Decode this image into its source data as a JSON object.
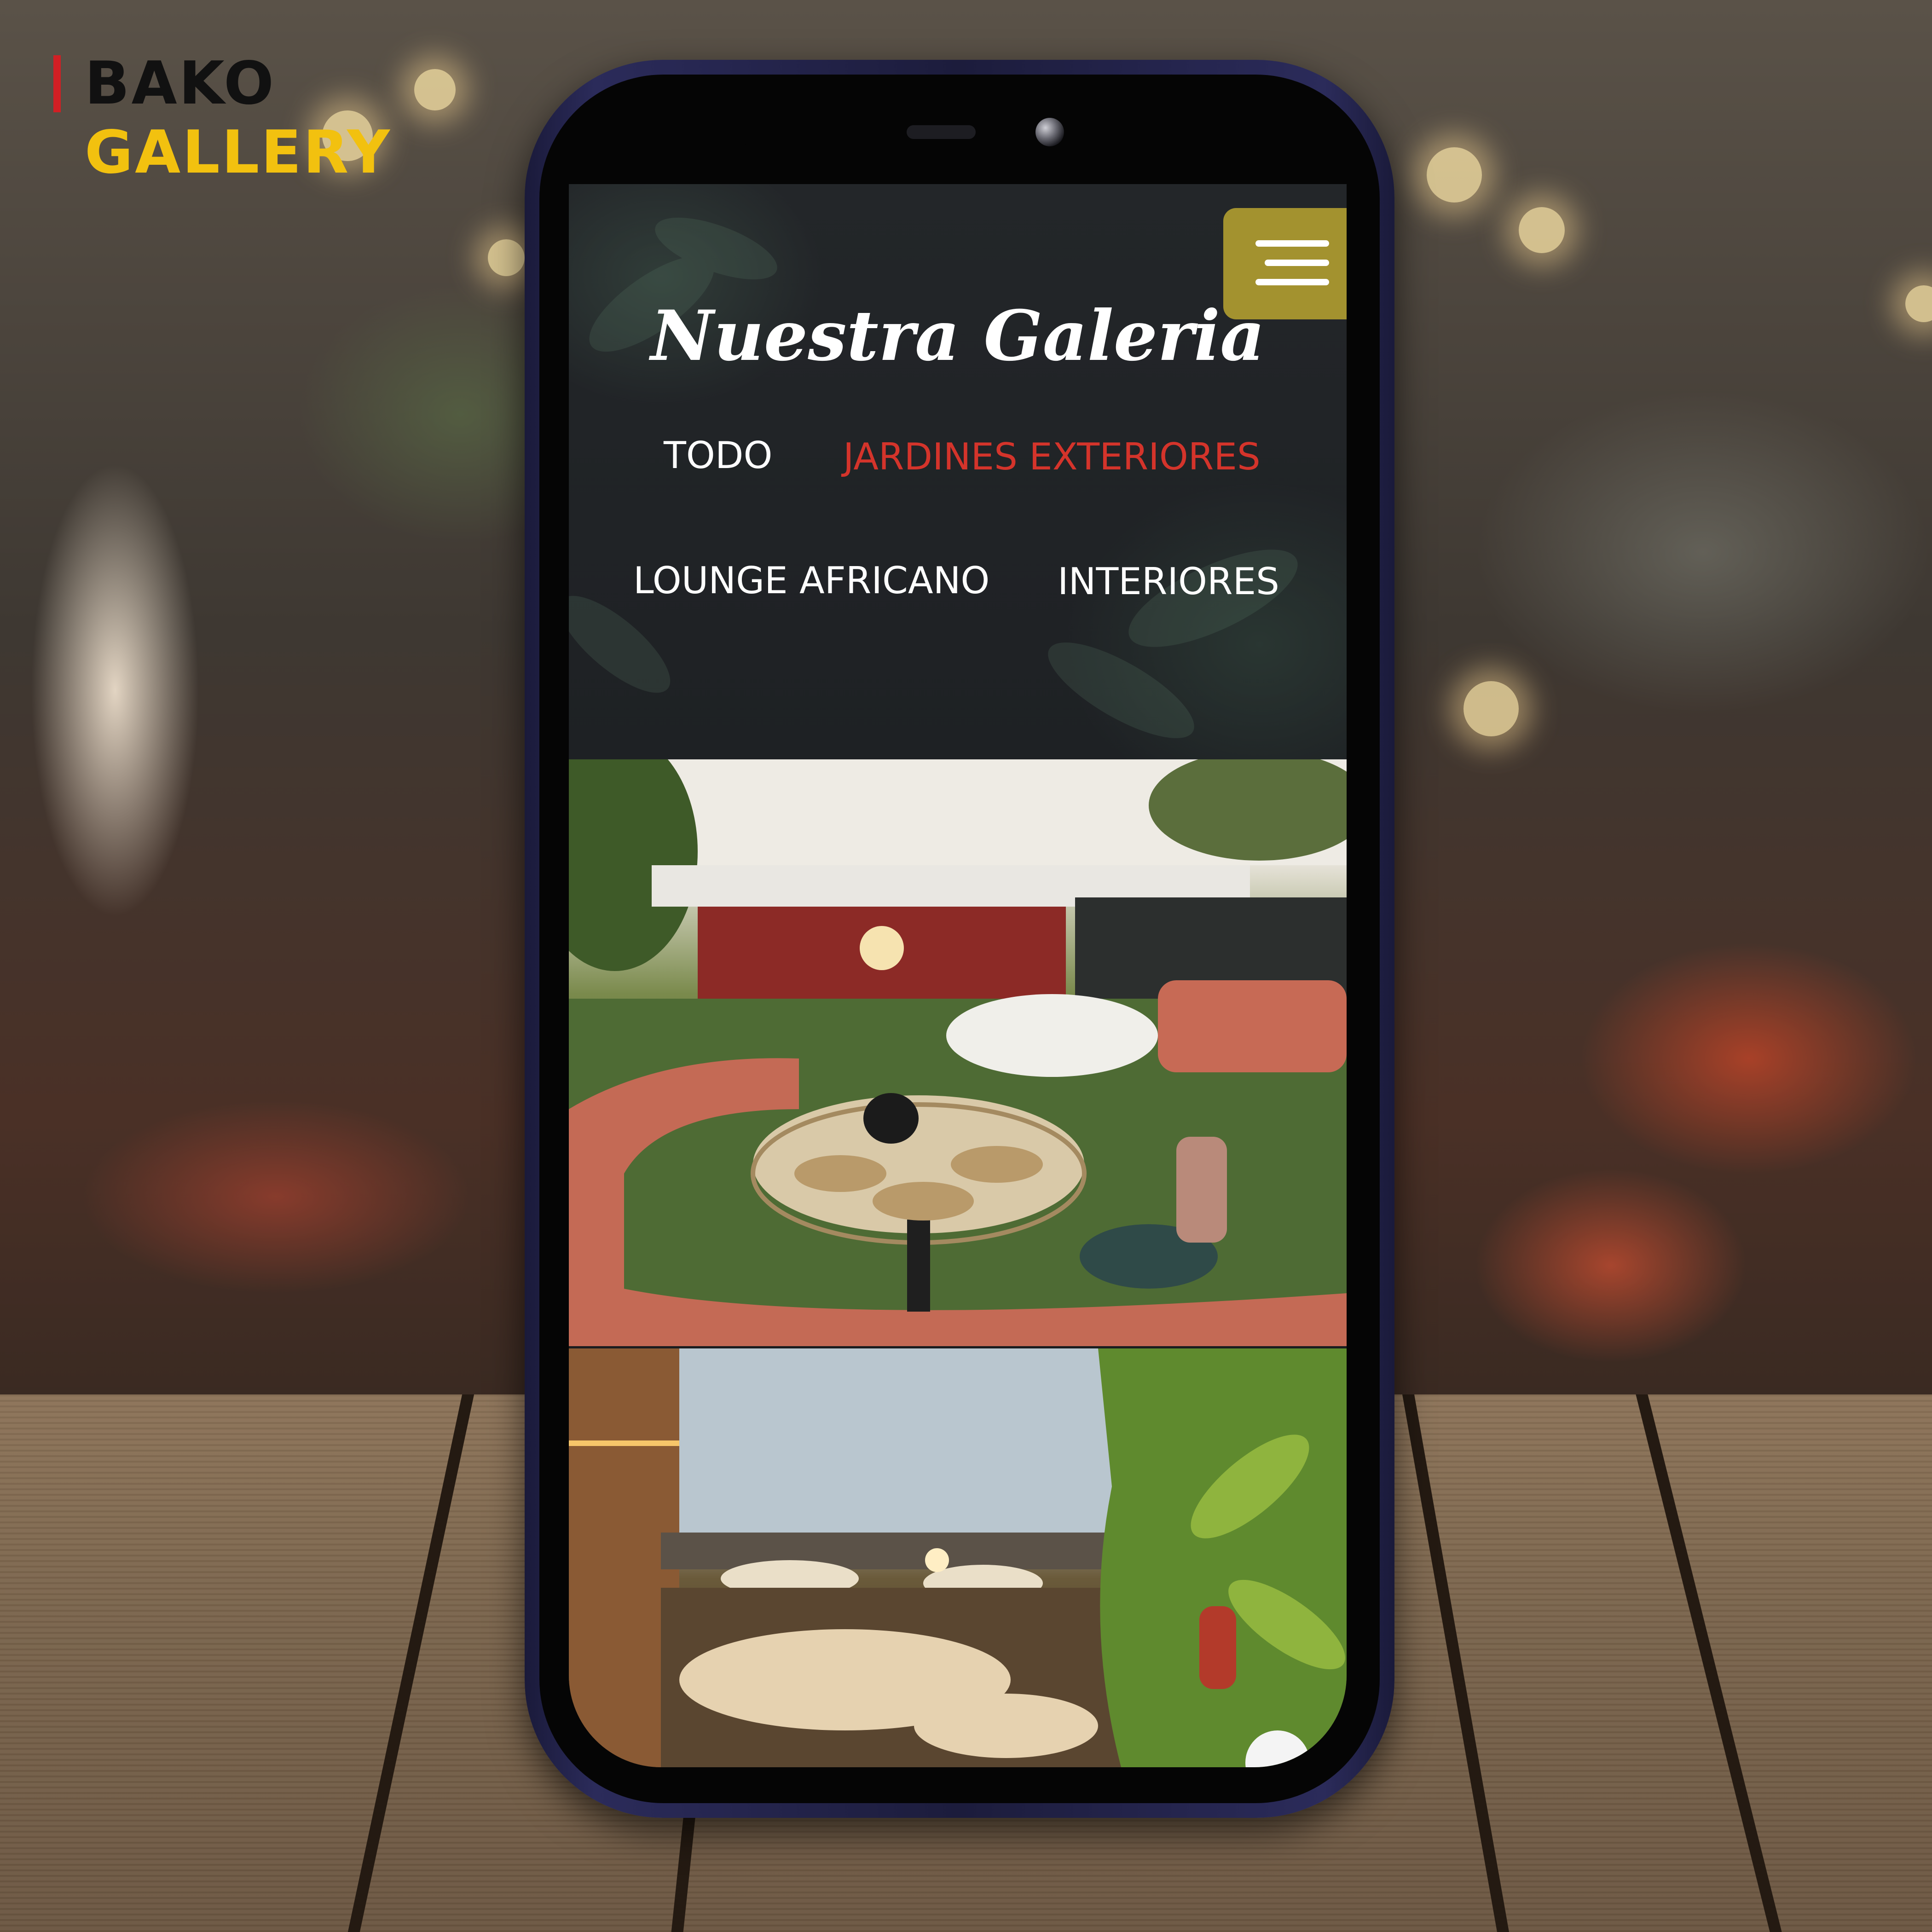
{
  "brand": {
    "name_line1": "BAKO",
    "name_line2": "GALLERY",
    "accent_red": "#d11f24",
    "accent_yellow": "#f2c10f"
  },
  "screen": {
    "title": "Nuestra Galeria",
    "menu_icon": "hamburger-menu-icon",
    "menu_button_color": "#a3922f",
    "filters": [
      {
        "label": "TODO",
        "active": false
      },
      {
        "label": "JARDINES EXTERIORES",
        "active": true
      },
      {
        "label": "LOUNGE AFRICANO",
        "active": false
      },
      {
        "label": "INTERIORES",
        "active": false
      }
    ],
    "active_filter_color": "#d4342b",
    "scroll_top_icon": "scroll-to-top-icon"
  }
}
